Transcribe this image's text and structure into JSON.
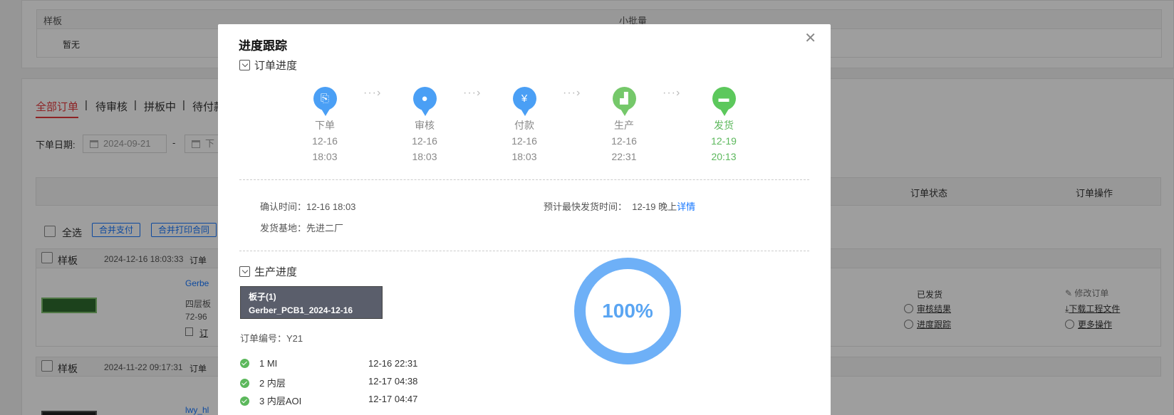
{
  "background": {
    "top_table": {
      "col1_header": "样板",
      "col2_header": "小批量",
      "col1_value": "暂无"
    },
    "tabs": [
      "全部订单",
      "待审核",
      "拼板中",
      "待付款"
    ],
    "tab_separator": "|",
    "filter": {
      "label": "下单日期:",
      "start_date": "2024-09-21",
      "dash": "-",
      "end_placeholder": "下"
    },
    "table_headers": {
      "status": "订单状态",
      "actions": "订单操作"
    },
    "toolbar": {
      "select_all": "全选",
      "merge_pay": "合并支付",
      "merge_print": "合并打印合同"
    },
    "orders": [
      {
        "type": "样板",
        "time": "2024-12-16 18:03:33",
        "no_label": "订单",
        "file": "Gerbe",
        "desc1": "四层板",
        "desc2": "72-96",
        "desc3": "订",
        "status": "已发货",
        "status_links": [
          "审核结果",
          "进度跟踪"
        ],
        "actions": [
          "修改订单",
          "下载工程文件",
          "更多操作"
        ]
      },
      {
        "type": "样板",
        "time": "2024-11-22 09:17:31",
        "no_label": "订单",
        "file": "lwy_hl"
      }
    ]
  },
  "modal": {
    "title": "进度跟踪",
    "close_icon": "close-icon",
    "order_progress_label": "订单进度",
    "steps": [
      {
        "name": "下单",
        "date": "12-16",
        "time": "18:03",
        "icon": "document-icon",
        "color": "#4a9ff5",
        "done": false
      },
      {
        "name": "审核",
        "date": "12-16",
        "time": "18:03",
        "icon": "person-icon",
        "color": "#4a9ff5",
        "done": false
      },
      {
        "name": "付款",
        "date": "12-16",
        "time": "18:03",
        "icon": "money-icon",
        "color": "#4a9ff5",
        "done": false
      },
      {
        "name": "生产",
        "date": "12-16",
        "time": "22:31",
        "icon": "factory-icon",
        "color": "#75c86a",
        "done": false
      },
      {
        "name": "发货",
        "date": "12-19",
        "time": "20:13",
        "icon": "truck-icon",
        "color": "#5cc85c",
        "done": true
      }
    ],
    "arrow_glyph": "···›",
    "confirm_label": "确认时间：",
    "confirm_value": "12-16 18:03",
    "eta_label": "预计最快发货时间：",
    "eta_value": "12-19 晚上",
    "eta_link": "详情",
    "base_label": "发货基地：",
    "base_value": "先进二厂",
    "production_progress_label": "生产进度",
    "board": {
      "line1": "板子(1)",
      "line2": "Gerber_PCB1_2024-12-16"
    },
    "order_no_label": "订单编号：",
    "order_no_value": "Y21",
    "process_items": [
      {
        "step": "1 MI",
        "time": "12-16 22:31"
      },
      {
        "step": "2 内层",
        "time": "12-17 04:38"
      },
      {
        "step": "3 内层AOI",
        "time": "12-17 04:47"
      }
    ],
    "percent_value": 100,
    "percent_text": "100%"
  }
}
